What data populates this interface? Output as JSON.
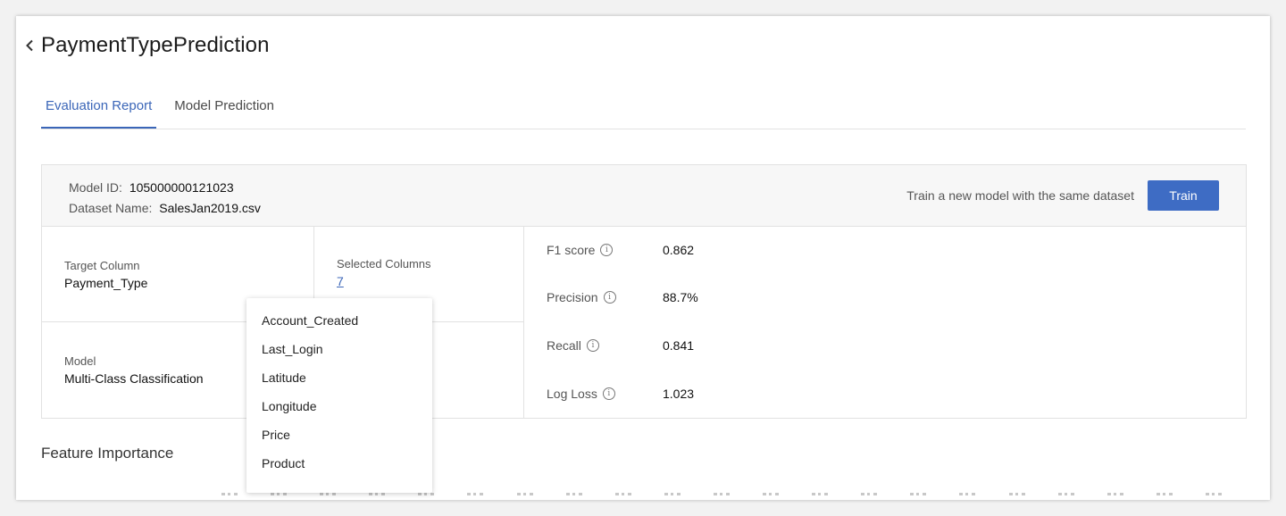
{
  "header": {
    "title": "PaymentTypePrediction"
  },
  "tabs": [
    {
      "label": "Evaluation Report",
      "active": true
    },
    {
      "label": "Model Prediction",
      "active": false
    }
  ],
  "info": {
    "model_id_label": "Model ID:",
    "model_id_value": "105000000121023",
    "dataset_label": "Dataset Name:",
    "dataset_value": "SalesJan2019.csv",
    "train_text": "Train a new model with the same dataset",
    "train_button": "Train"
  },
  "cells": {
    "target_label": "Target Column",
    "target_value": "Payment_Type",
    "selected_label": "Selected Columns",
    "selected_value": "7",
    "model_label": "Model",
    "model_value": "Multi-Class Classification"
  },
  "metrics": [
    {
      "name": "F1 score",
      "value": "0.862"
    },
    {
      "name": "Precision",
      "value": "88.7%"
    },
    {
      "name": "Recall",
      "value": "0.841"
    },
    {
      "name": "Log Loss",
      "value": "1.023"
    }
  ],
  "dropdown": {
    "items": [
      "Account_Created",
      "Last_Login",
      "Latitude",
      "Longitude",
      "Price",
      "Product"
    ]
  },
  "feature_importance": {
    "title": "Feature Importance"
  },
  "colors": {
    "accent": "#3e6cc4",
    "link": "#3b66b8"
  }
}
